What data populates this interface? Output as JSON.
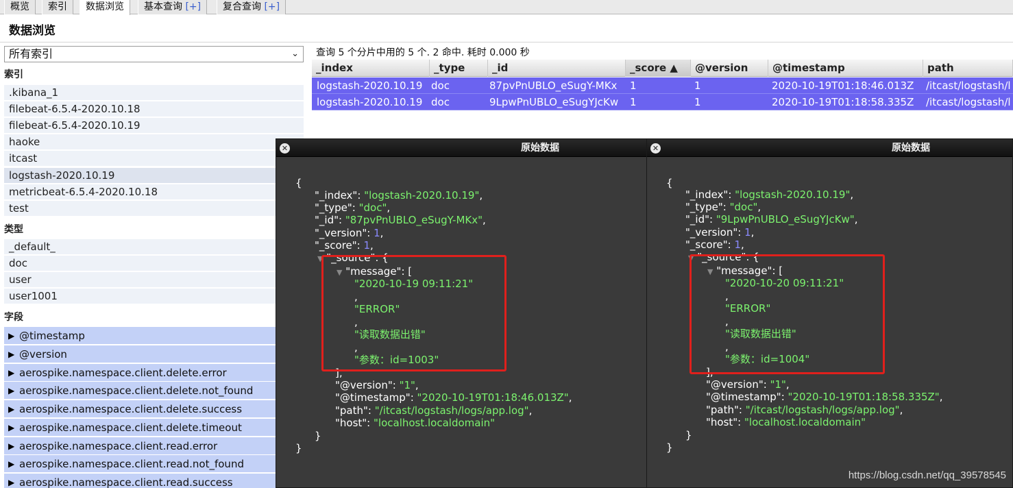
{
  "tabs": [
    {
      "label": "概览",
      "plus": ""
    },
    {
      "label": "索引",
      "plus": ""
    },
    {
      "label": "数据浏览",
      "plus": ""
    },
    {
      "label": "基本查询",
      "plus": "[+]"
    },
    {
      "label": "复合查询",
      "plus": "[+]"
    }
  ],
  "page_title": "数据浏览",
  "sidebar": {
    "index_select": "所有索引",
    "indices_header": "索引",
    "indices": [
      ".kibana_1",
      "filebeat-6.5.4-2020.10.18",
      "filebeat-6.5.4-2020.10.19",
      "haoke",
      "itcast",
      "logstash-2020.10.19",
      "metricbeat-6.5.4-2020.10.18",
      "test"
    ],
    "types_header": "类型",
    "types": [
      "_default_",
      "doc",
      "user",
      "user1001"
    ],
    "fields_header": "字段",
    "fields": [
      "@timestamp",
      "@version",
      "aerospike.namespace.client.delete.error",
      "aerospike.namespace.client.delete.not_found",
      "aerospike.namespace.client.delete.success",
      "aerospike.namespace.client.delete.timeout",
      "aerospike.namespace.client.read.error",
      "aerospike.namespace.client.read.not_found",
      "aerospike.namespace.client.read.success"
    ],
    "help_mark": "?"
  },
  "results": {
    "summary": "查询 5 个分片中用的 5 个. 2 命中. 耗时 0.000 秒",
    "columns": [
      "_index",
      "_type",
      "_id",
      "_score ▲",
      "@version",
      "@timestamp",
      "path"
    ],
    "rows": [
      [
        "logstash-2020.10.19",
        "doc",
        "87pvPnUBLO_eSugY-MKx",
        "1",
        "1",
        "2020-10-19T01:18:46.013Z",
        "/itcast/logstash/l"
      ],
      [
        "logstash-2020.10.19",
        "doc",
        "9LpwPnUBLO_eSugYJcKw",
        "1",
        "1",
        "2020-10-19T01:18:58.335Z",
        "/itcast/logstash/l"
      ]
    ]
  },
  "popups": [
    {
      "title": "原始数据",
      "index": "\"logstash-2020.10.19\"",
      "type": "\"doc\"",
      "id": "\"87pvPnUBLO_eSugY-MKx\"",
      "version": "1",
      "score": "1",
      "msg_date": "\"2020-10-19 09:11:21\"",
      "msg_level": "\"ERROR\"",
      "msg_text": "\"读取数据出错\"",
      "msg_param": "\"参数：id=1003\"",
      "at_version": "\"1\"",
      "at_timestamp": "\"2020-10-19T01:18:46.013Z\"",
      "path": "\"/itcast/logstash/logs/app.log\"",
      "host": "\"localhost.localdomain\""
    },
    {
      "title": "原始数据",
      "index": "\"logstash-2020.10.19\"",
      "type": "\"doc\"",
      "id": "\"9LpwPnUBLO_eSugYJcKw\"",
      "version": "1",
      "score": "1",
      "msg_date": "\"2020-10-20 09:11:21\"",
      "msg_level": "\"ERROR\"",
      "msg_text": "\"读取数据出错\"",
      "msg_param": "\"参数：id=1004\"",
      "at_version": "\"1\"",
      "at_timestamp": "\"2020-10-19T01:18:58.335Z\"",
      "path": "\"/itcast/logstash/logs/app.log\"",
      "host": "\"localhost.localdomain\""
    }
  ],
  "watermark": "https://blog.csdn.net/qq_39578545",
  "colors": {
    "row_selected": "#6b63f0",
    "field_bg": "#c3d1f7",
    "json_string": "#7cf26e",
    "json_number": "#8b8bff",
    "highlight_box": "#e0201c"
  }
}
